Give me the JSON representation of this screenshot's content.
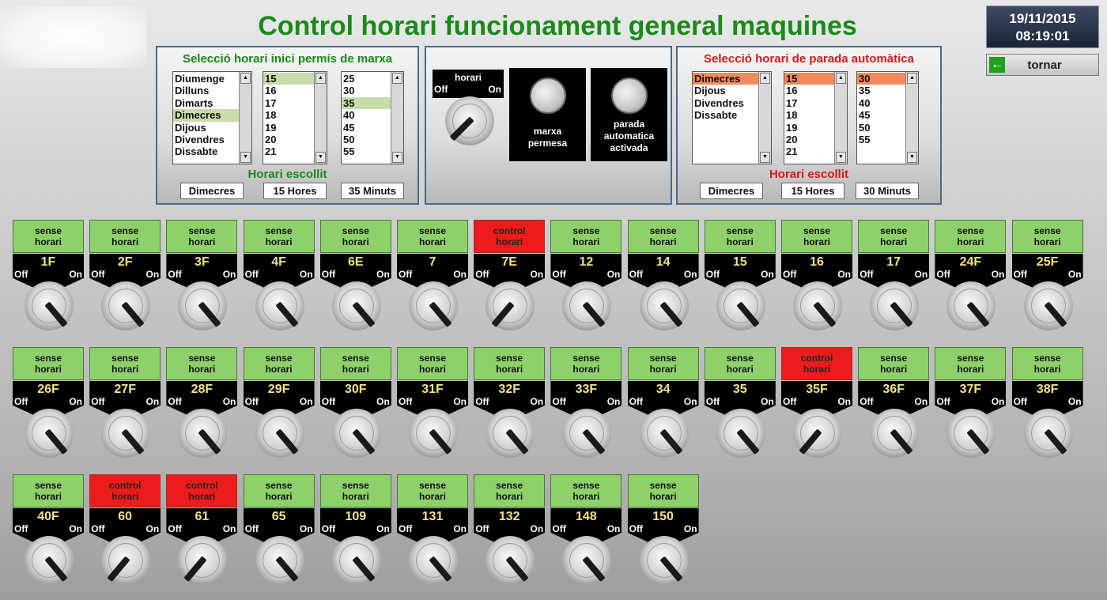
{
  "header": {
    "title": "Control horari funcionament general maquines",
    "date": "19/11/2015",
    "time": "08:19:01",
    "back_label": "tornar"
  },
  "start_panel": {
    "title": "Selecció horari inici permís de marxa",
    "days": [
      "Diumenge",
      "Dilluns",
      "Dimarts",
      "Dimecres",
      "Dijous",
      "Divendres",
      "Dissabte"
    ],
    "days_selected": 3,
    "hours": [
      "15",
      "16",
      "17",
      "18",
      "19",
      "20",
      "21"
    ],
    "hours_selected": 0,
    "minutes": [
      "25",
      "30",
      "35",
      "40",
      "45",
      "50",
      "55"
    ],
    "minutes_selected": 2,
    "chosen_label": "Horari escollit",
    "chosen_day": "Dimecres",
    "chosen_hour": "15 Hores",
    "chosen_minute": "35 Minuts"
  },
  "center_panel": {
    "switch_label": "horari",
    "off_label": "Off",
    "on_label": "On",
    "lamp1_label_line1": "marxa",
    "lamp1_label_line2": "permesa",
    "lamp2_label_line1": "parada",
    "lamp2_label_line2": "automatica",
    "lamp2_label_line3": "activada"
  },
  "stop_panel": {
    "title": "Selecció horari de parada automàtica",
    "days": [
      "Dimecres",
      "Dijous",
      "Divendres",
      "Dissabte"
    ],
    "days_selected": 0,
    "hours": [
      "15",
      "16",
      "17",
      "18",
      "19",
      "20",
      "21"
    ],
    "hours_selected": 0,
    "minutes": [
      "30",
      "35",
      "40",
      "45",
      "50",
      "55"
    ],
    "minutes_selected": 0,
    "chosen_label": "Horari escollit",
    "chosen_day": "Dimecres",
    "chosen_hour": "15 Hores",
    "chosen_minute": "30 Minuts"
  },
  "status_texts": {
    "green": [
      "sense",
      "horari"
    ],
    "red": [
      "control",
      "horari"
    ]
  },
  "machines": [
    {
      "code": "1F",
      "status": "sense"
    },
    {
      "code": "2F",
      "status": "sense"
    },
    {
      "code": "3F",
      "status": "sense"
    },
    {
      "code": "4F",
      "status": "sense"
    },
    {
      "code": "6E",
      "status": "sense"
    },
    {
      "code": "7",
      "status": "sense"
    },
    {
      "code": "7E",
      "status": "control"
    },
    {
      "code": "12",
      "status": "sense"
    },
    {
      "code": "14",
      "status": "sense"
    },
    {
      "code": "15",
      "status": "sense"
    },
    {
      "code": "16",
      "status": "sense"
    },
    {
      "code": "17",
      "status": "sense"
    },
    {
      "code": "24F",
      "status": "sense"
    },
    {
      "code": "25F",
      "status": "sense"
    },
    {
      "code": "26F",
      "status": "sense"
    },
    {
      "code": "27F",
      "status": "sense"
    },
    {
      "code": "28F",
      "status": "sense"
    },
    {
      "code": "29F",
      "status": "sense"
    },
    {
      "code": "30F",
      "status": "sense"
    },
    {
      "code": "31F",
      "status": "sense"
    },
    {
      "code": "32F",
      "status": "sense"
    },
    {
      "code": "33F",
      "status": "sense"
    },
    {
      "code": "34",
      "status": "sense"
    },
    {
      "code": "35",
      "status": "sense"
    },
    {
      "code": "35F",
      "status": "control"
    },
    {
      "code": "36F",
      "status": "sense"
    },
    {
      "code": "37F",
      "status": "sense"
    },
    {
      "code": "38F",
      "status": "sense"
    },
    {
      "code": "40F",
      "status": "sense"
    },
    {
      "code": "60",
      "status": "control"
    },
    {
      "code": "61",
      "status": "control"
    },
    {
      "code": "65",
      "status": "sense"
    },
    {
      "code": "109",
      "status": "sense"
    },
    {
      "code": "131",
      "status": "sense"
    },
    {
      "code": "132",
      "status": "sense"
    },
    {
      "code": "148",
      "status": "sense"
    },
    {
      "code": "150",
      "status": "sense"
    }
  ],
  "colors": {
    "title_green": "#1a8a1a",
    "title_red": "#d41a1a",
    "status_green": "#8ed06a",
    "status_red": "#ec1c1c",
    "code_yellow": "#f2e28a"
  }
}
